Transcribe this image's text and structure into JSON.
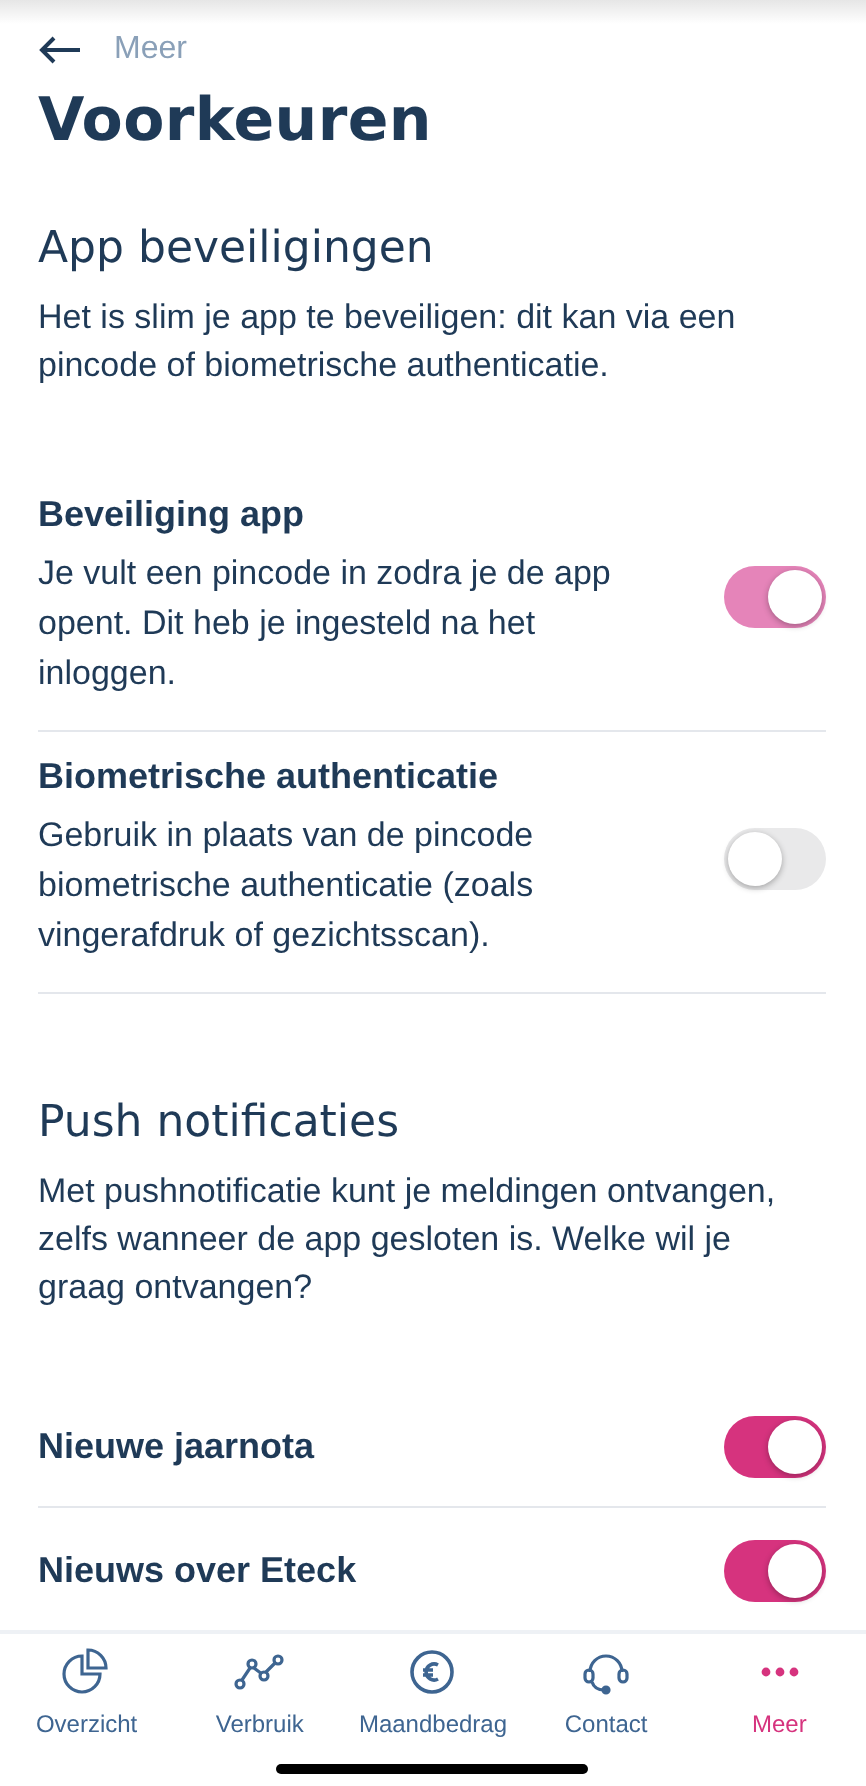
{
  "header": {
    "back_label": "Meer",
    "title": "Voorkeuren"
  },
  "sections": [
    {
      "heading": "App beveiligingen",
      "intro": "Het is slim je app te beveiligen: dit kan via een pincode of biometrische authenticatie.",
      "items": [
        {
          "kind": "described",
          "title": "Beveiliging app",
          "description": "Je vult een pincode in zodra je de app opent. Dit heb je ingesteld na het inloggen.",
          "on": true,
          "disabled": true
        },
        {
          "kind": "described",
          "title": "Biometrische authenticatie",
          "description": "Gebruik in plaats van de pincode biometrische authenticatie (zoals vingerafdruk of gezichtsscan).",
          "on": false,
          "disabled": false
        }
      ]
    },
    {
      "heading": "Push notificaties",
      "intro": "Met pushnotificatie kunt je meldingen ontvangen, zelfs wanneer de app gesloten is. Welke wil je graag ontvangen?",
      "items": [
        {
          "kind": "simple",
          "title": "Nieuwe jaarnota",
          "on": true,
          "disabled": false
        },
        {
          "kind": "simple",
          "title": "Nieuws over Eteck",
          "on": true,
          "disabled": false
        }
      ]
    }
  ],
  "tab_bar": [
    {
      "kind": "pie",
      "label": "Overzicht",
      "selected": false
    },
    {
      "kind": "graph",
      "label": "Verbruik",
      "selected": false
    },
    {
      "kind": "euro",
      "label": "Maandbedrag",
      "selected": false
    },
    {
      "kind": "headset",
      "label": "Contact",
      "selected": false
    },
    {
      "kind": "dots",
      "label": "Meer",
      "selected": true
    }
  ]
}
